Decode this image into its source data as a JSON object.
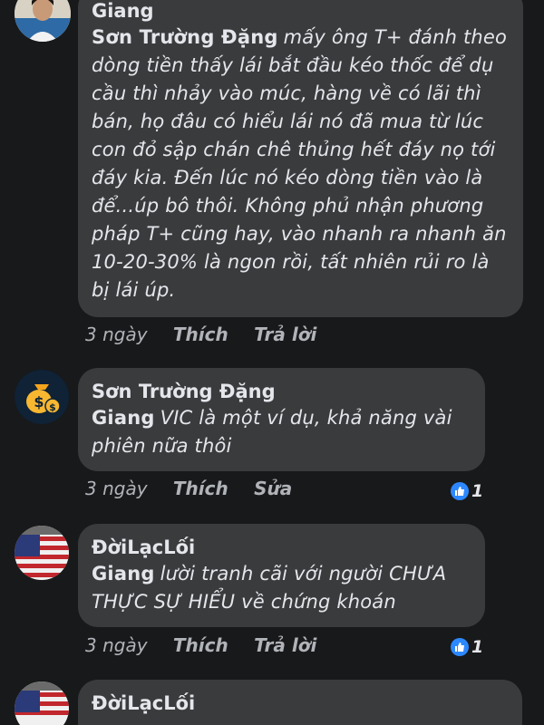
{
  "comments": [
    {
      "author": "Giang",
      "mention": "Sơn Trường Đặng",
      "text": "mấy ông T+ đánh theo dòng tiền thấy lái bắt đầu kéo thốc để dụ cầu thì nhảy vào múc, hàng về có lãi thì bán, họ đâu có hiểu lái nó đã mua từ lúc con đỏ sập chán chê thủng hết đáy nọ tới đáy kia. Đến lúc nó kéo dòng tiền vào là để...úp bô thôi. Không phủ nhận phương pháp T+ cũng hay, vào nhanh ra nhanh ăn 10-20-30% là ngon rồi, tất nhiên rủi ro là bị lái úp.",
      "time": "3 ngày",
      "like_label": "Thích",
      "action_label": "Trả lời",
      "avatar_icon": "user-photo-icon"
    },
    {
      "author": "Sơn Trường Đặng",
      "mention": "Giang",
      "text": "VIC là một ví dụ, khả năng vài phiên nữa thôi",
      "time": "3 ngày",
      "like_label": "Thích",
      "action_label": "Sửa",
      "reaction_count": "1",
      "avatar_icon": "money-bag-icon"
    },
    {
      "author": "ĐờiLạcLối",
      "mention": "Giang",
      "text": "lười tranh cãi với người CHƯA THỰC SỰ HIỂU về chứng khoán",
      "time": "3 ngày",
      "like_label": "Thích",
      "action_label": "Trả lời",
      "reaction_count": "1",
      "avatar_icon": "us-flag-icon"
    },
    {
      "author": "ĐờiLạcLối",
      "avatar_icon": "us-flag-icon"
    }
  ],
  "colors": {
    "background": "#18191a",
    "bubble": "#3a3b3c",
    "text": "#e4e6eb",
    "meta": "#b0b3b8",
    "like_blue": "#2d88ff"
  }
}
